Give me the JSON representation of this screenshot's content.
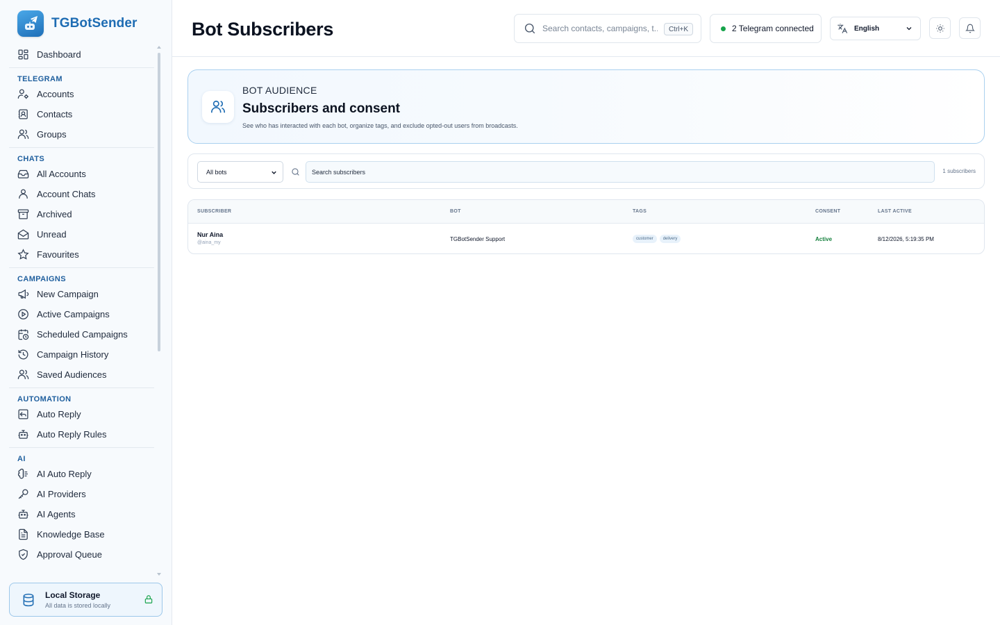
{
  "app": {
    "name": "TGBotSender"
  },
  "sidebar": {
    "dashboard": "Dashboard",
    "sections": [
      {
        "title": "TELEGRAM",
        "items": [
          {
            "label": "Accounts",
            "icon": "user-cog-icon"
          },
          {
            "label": "Contacts",
            "icon": "contact-book-icon"
          },
          {
            "label": "Groups",
            "icon": "users-icon"
          }
        ]
      },
      {
        "title": "CHATS",
        "items": [
          {
            "label": "All Accounts",
            "icon": "inbox-icon"
          },
          {
            "label": "Account Chats",
            "icon": "user-icon"
          },
          {
            "label": "Archived",
            "icon": "archive-icon"
          },
          {
            "label": "Unread",
            "icon": "mail-open-icon"
          },
          {
            "label": "Favourites",
            "icon": "star-icon"
          }
        ]
      },
      {
        "title": "CAMPAIGNS",
        "items": [
          {
            "label": "New Campaign",
            "icon": "megaphone-icon"
          },
          {
            "label": "Active Campaigns",
            "icon": "play-circle-icon"
          },
          {
            "label": "Scheduled Campaigns",
            "icon": "calendar-clock-icon"
          },
          {
            "label": "Campaign History",
            "icon": "history-icon"
          },
          {
            "label": "Saved Audiences",
            "icon": "users-icon"
          }
        ]
      },
      {
        "title": "AUTOMATION",
        "items": [
          {
            "label": "Auto Reply",
            "icon": "reply-icon"
          },
          {
            "label": "Auto Reply Rules",
            "icon": "bot-icon"
          }
        ]
      },
      {
        "title": "AI",
        "items": [
          {
            "label": "AI Auto Reply",
            "icon": "brain-icon"
          },
          {
            "label": "AI Providers",
            "icon": "key-icon"
          },
          {
            "label": "AI Agents",
            "icon": "bot-icon"
          },
          {
            "label": "Knowledge Base",
            "icon": "file-text-icon"
          },
          {
            "label": "Approval Queue",
            "icon": "shield-check-icon"
          }
        ]
      }
    ],
    "storage": {
      "title": "Local Storage",
      "subtitle": "All data is stored locally"
    }
  },
  "header": {
    "title": "Bot Subscribers",
    "search_placeholder": "Search contacts, campaigns, t...",
    "shortcut": "Ctrl+K",
    "status": "2 Telegram connected",
    "language": "English"
  },
  "hero": {
    "eyebrow": "BOT AUDIENCE",
    "title": "Subscribers and consent",
    "description": "See who has interacted with each bot, organize tags, and exclude opted-out users from broadcasts."
  },
  "filters": {
    "bot_select": "All bots",
    "search_placeholder": "Search subscribers",
    "count": "1 subscribers"
  },
  "table": {
    "columns": [
      "SUBSCRIBER",
      "BOT",
      "TAGS",
      "CONSENT",
      "LAST ACTIVE"
    ],
    "rows": [
      {
        "name": "Nur Aina",
        "handle": "@aina_my",
        "bot": "TGBotSender Support",
        "tags": [
          "customer",
          "delivery"
        ],
        "consent": "Active",
        "last_active": "8/12/2026, 5:19:35 PM"
      }
    ]
  },
  "colors": {
    "accent": "#1e6cb3",
    "section": "#1f5f9e",
    "success": "#15803d"
  }
}
